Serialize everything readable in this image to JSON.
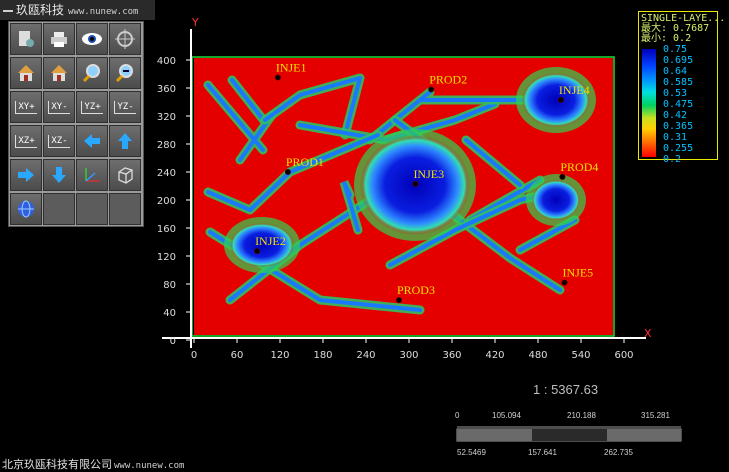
{
  "app": {
    "title": "玖瓯科技",
    "url": "www.nunew.com"
  },
  "toolbar": {
    "buttons": [
      {
        "icon": "document-settings-icon"
      },
      {
        "icon": "printer-icon"
      },
      {
        "icon": "eye-icon"
      },
      {
        "icon": "crosshair-icon"
      },
      {
        "icon": "home-icon"
      },
      {
        "icon": "home-reset-icon"
      },
      {
        "icon": "zoom-in-icon"
      },
      {
        "icon": "zoom-out-icon"
      },
      {
        "icon": "view-xy-plus-icon",
        "label": "XY+"
      },
      {
        "icon": "view-xy-minus-icon",
        "label": "XY-"
      },
      {
        "icon": "view-yz-plus-icon",
        "label": "YZ+"
      },
      {
        "icon": "view-yz-minus-icon",
        "label": "YZ-"
      },
      {
        "icon": "view-xz-plus-icon",
        "label": "XZ+"
      },
      {
        "icon": "view-xz-minus-icon",
        "label": "XZ-"
      },
      {
        "icon": "arrow-left-icon"
      },
      {
        "icon": "arrow-up-icon"
      },
      {
        "icon": "arrow-right-icon"
      },
      {
        "icon": "arrow-down-icon"
      },
      {
        "icon": "axes-icon"
      },
      {
        "icon": "cube-icon"
      },
      {
        "icon": "globe-icon"
      }
    ]
  },
  "plot": {
    "x_axis_label": "X",
    "y_axis_label": "Y",
    "x_ticks": [
      "0",
      "60",
      "120",
      "180",
      "240",
      "300",
      "360",
      "420",
      "480",
      "540",
      "600"
    ],
    "y_ticks": [
      "0",
      "40",
      "80",
      "120",
      "160",
      "200",
      "240",
      "280",
      "320",
      "360",
      "400"
    ],
    "wells": [
      {
        "name": "INJE1",
        "x": 117,
        "y": 375
      },
      {
        "name": "PROD2",
        "x": 331,
        "y": 358
      },
      {
        "name": "INJE4",
        "x": 512,
        "y": 343
      },
      {
        "name": "PROD1",
        "x": 131,
        "y": 240
      },
      {
        "name": "INJE3",
        "x": 309,
        "y": 223
      },
      {
        "name": "PROD4",
        "x": 514,
        "y": 233
      },
      {
        "name": "INJE2",
        "x": 88,
        "y": 127
      },
      {
        "name": "PROD3",
        "x": 286,
        "y": 57
      },
      {
        "name": "INJE5",
        "x": 517,
        "y": 82
      }
    ]
  },
  "colorbar": {
    "title": "SINGLE-LAYE...",
    "max_label": "最大: 0.7687",
    "min_label": "最小: 0.2",
    "ticks": [
      "0.75",
      "0.695",
      "0.64",
      "0.585",
      "0.53",
      "0.475",
      "0.42",
      "0.365",
      "0.31",
      "0.255",
      "0.2"
    ]
  },
  "scale": {
    "ratio_text": "1 : 5367.63",
    "top_labels": [
      "0",
      "105.094",
      "210.188",
      "315.281"
    ],
    "bottom_labels": [
      "52.5469",
      "157.641",
      "262.735"
    ]
  },
  "footer": {
    "company": "北京玖瓯科技有限公司",
    "url": "www.nunew.com"
  },
  "colors": {
    "background": "#000000",
    "field_red": "#e50000",
    "axis": "#ffffff",
    "well_label": "#f0e000",
    "colorbar_border": "#e8e800"
  }
}
